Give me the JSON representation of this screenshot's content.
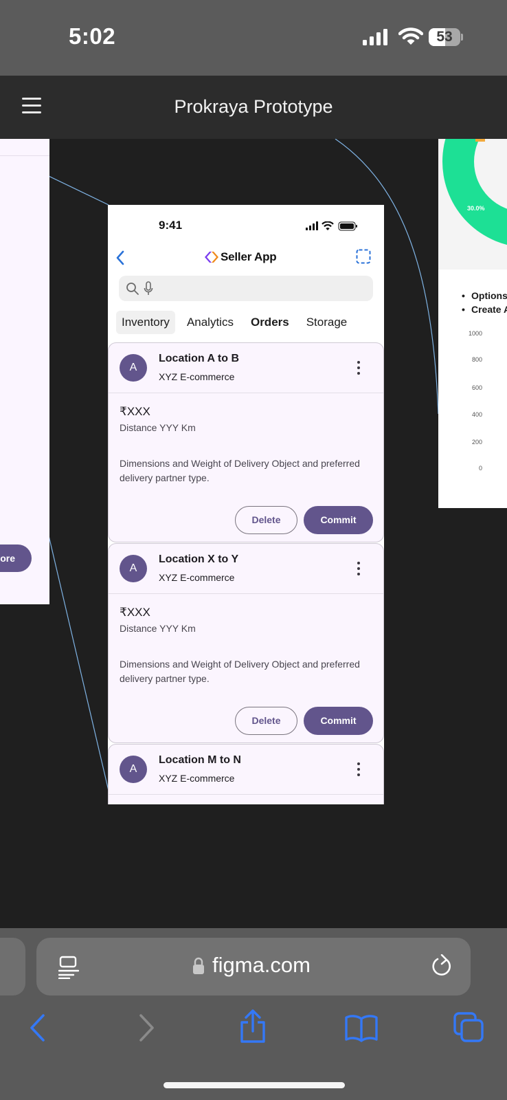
{
  "status_bar": {
    "time": "5:02",
    "battery": "53"
  },
  "figma": {
    "title": "Prokraya Prototype"
  },
  "canvas": {
    "left_frame": {
      "button_label": "r store"
    },
    "right_frame": {
      "donut_label": "30.0%",
      "bullets": [
        "Options",
        "Create A"
      ],
      "y_ticks": [
        "1000",
        "800",
        "600",
        "400",
        "200",
        "0"
      ]
    }
  },
  "prototype": {
    "time": "9:41",
    "app_name": "Seller App",
    "search": {
      "placeholder": ""
    },
    "tabs": [
      "Inventory",
      "Analytics",
      "Orders",
      "Storage"
    ],
    "active_tab": "Orders",
    "orders": [
      {
        "avatar": "A",
        "title": "Location A to B",
        "company": "XYZ E-commerce",
        "price": "₹XXX",
        "distance": "Distance YYY Km",
        "description": "Dimensions and Weight of Delivery Object and preferred delivery partner type.",
        "delete_label": "Delete",
        "commit_label": "Commit"
      },
      {
        "avatar": "A",
        "title": "Location X to Y",
        "company": "XYZ E-commerce",
        "price": "₹XXX",
        "distance": "Distance YYY Km",
        "description": "Dimensions and Weight of Delivery Object and preferred delivery partner type.",
        "delete_label": "Delete",
        "commit_label": "Commit"
      },
      {
        "avatar": "A",
        "title": "Location M to N",
        "company": "XYZ E-commerce"
      }
    ]
  },
  "browser": {
    "url": "figma.com"
  },
  "colors": {
    "accent": "#62558c",
    "card_bg": "#fbf5fe",
    "canvas_bg": "#1f1f1f",
    "safari_blue": "#3478f6",
    "donut_green": "#1de095"
  },
  "icons": [
    "hamburger-icon",
    "back-chevron-icon",
    "brand-logo-icon",
    "select-frame-icon",
    "search-icon",
    "mic-icon",
    "more-vert-icon",
    "reader-icon",
    "lock-icon",
    "reload-icon",
    "back-icon",
    "forward-icon",
    "share-icon",
    "bookmarks-icon",
    "tabs-icon"
  ]
}
